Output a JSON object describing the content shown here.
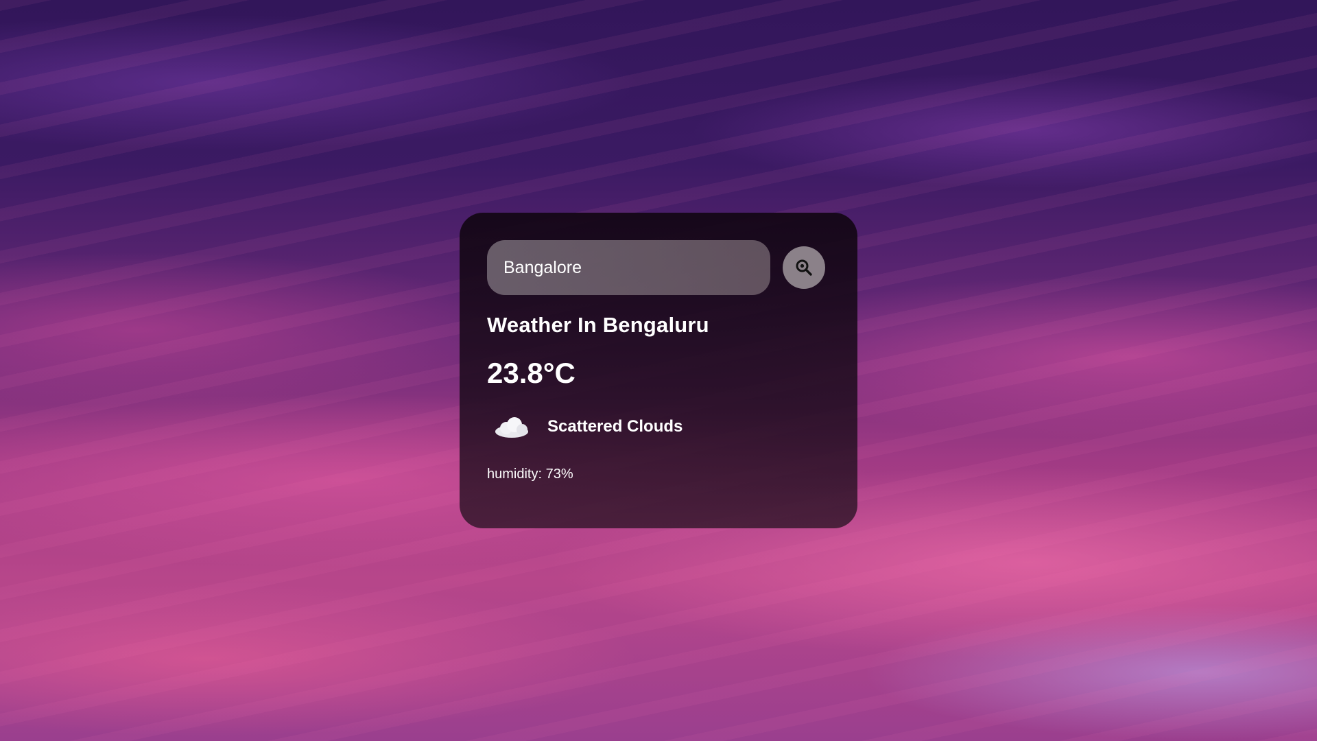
{
  "search": {
    "value": "Bangalore",
    "button_icon": "search-icon"
  },
  "weather": {
    "title": "Weather In Bengaluru",
    "temperature": "23.8°C",
    "condition_icon": "cloud-icon",
    "description": "Scattered Clouds",
    "humidity": "humidity: 73%"
  },
  "colors": {
    "card_background": "#140814",
    "button_background": "#8b8189",
    "text": "#ffffff"
  }
}
